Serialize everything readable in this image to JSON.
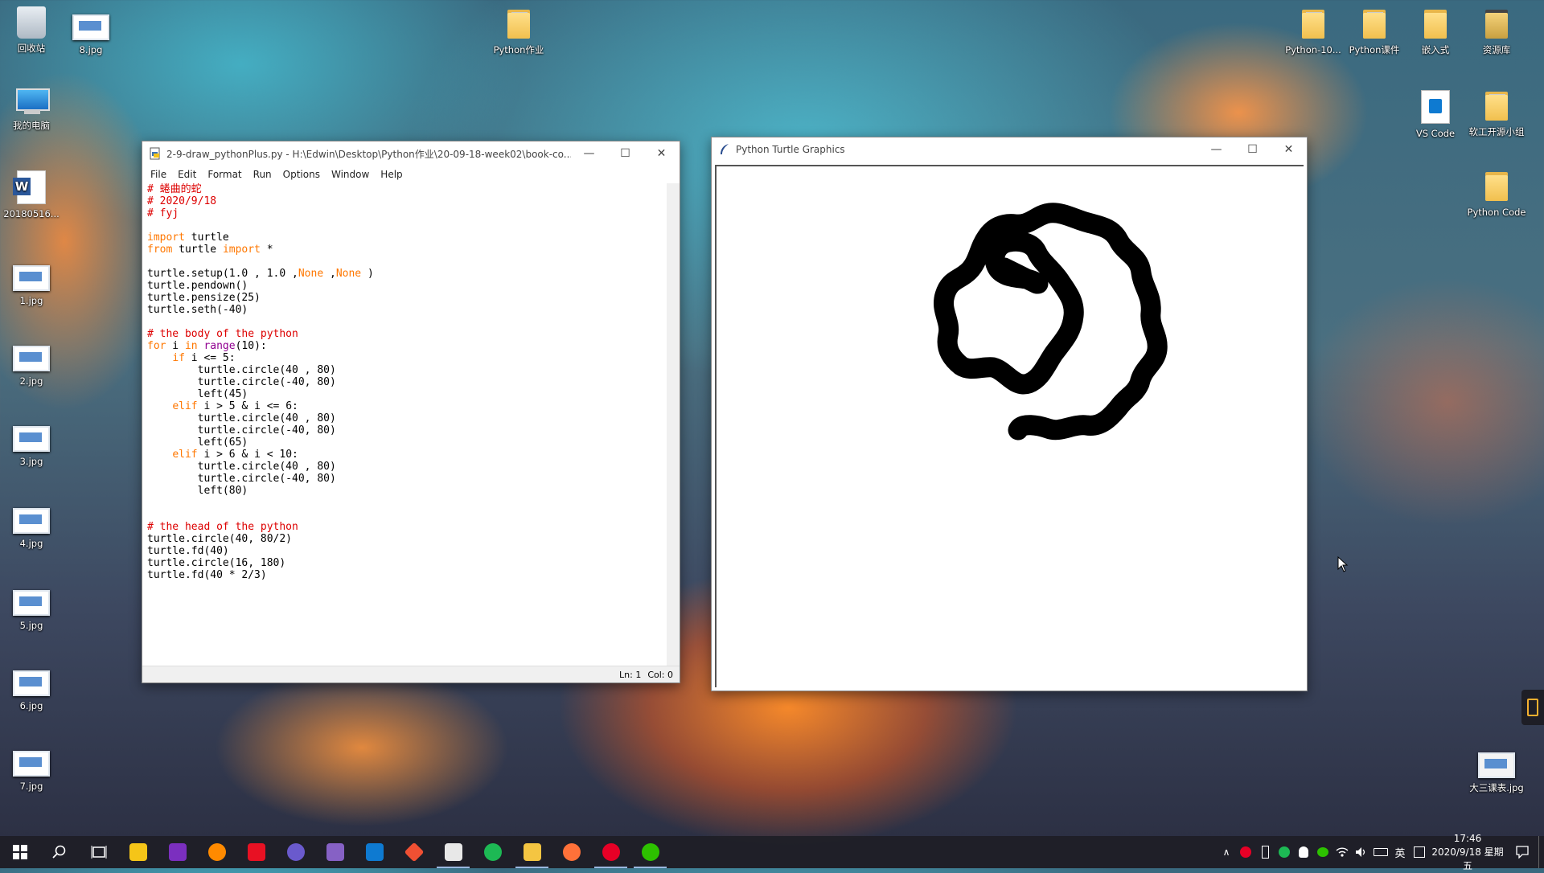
{
  "desktop": {
    "icons": [
      {
        "label": "回收站"
      },
      {
        "label": "8.jpg"
      },
      {
        "label": "我的电脑"
      },
      {
        "label": "20180516..."
      },
      {
        "label": "1.jpg"
      },
      {
        "label": "2.jpg"
      },
      {
        "label": "3.jpg"
      },
      {
        "label": "4.jpg"
      },
      {
        "label": "5.jpg"
      },
      {
        "label": "6.jpg"
      },
      {
        "label": "7.jpg"
      },
      {
        "label": "Python作业"
      },
      {
        "label": "Python-10..."
      },
      {
        "label": "Python课件"
      },
      {
        "label": "嵌入式"
      },
      {
        "label": "资源库"
      },
      {
        "label": "VS Code"
      },
      {
        "label": "软工开源小组"
      },
      {
        "label": "Python Code"
      },
      {
        "label": "大三课表.jpg"
      }
    ]
  },
  "editor": {
    "title": "2-9-draw_pythonPlus.py - H:\\Edwin\\Desktop\\Python作业\\20-09-18-week02\\book-co...",
    "menu": [
      "File",
      "Edit",
      "Format",
      "Run",
      "Options",
      "Window",
      "Help"
    ],
    "code": [
      [
        {
          "c": "cm",
          "t": "# 蜷曲的蛇"
        }
      ],
      [
        {
          "c": "cm",
          "t": "# 2020/9/18"
        }
      ],
      [
        {
          "c": "cm",
          "t": "# fyj"
        }
      ],
      [],
      [
        {
          "c": "kw",
          "t": "import"
        },
        {
          "t": " turtle"
        }
      ],
      [
        {
          "c": "kw",
          "t": "from"
        },
        {
          "t": " turtle "
        },
        {
          "c": "kw",
          "t": "import"
        },
        {
          "t": " *"
        }
      ],
      [],
      [
        {
          "t": "turtle.setup(1.0 , 1.0 ,"
        },
        {
          "c": "kw",
          "t": "None"
        },
        {
          "t": " ,"
        },
        {
          "c": "kw",
          "t": "None"
        },
        {
          "t": " )"
        }
      ],
      [
        {
          "t": "turtle.pendown()"
        }
      ],
      [
        {
          "t": "turtle.pensize(25)"
        }
      ],
      [
        {
          "t": "turtle.seth(-40)"
        }
      ],
      [],
      [
        {
          "c": "cm",
          "t": "# the body of the python"
        }
      ],
      [
        {
          "c": "kw",
          "t": "for"
        },
        {
          "t": " i "
        },
        {
          "c": "kw",
          "t": "in"
        },
        {
          "t": " "
        },
        {
          "c": "bi",
          "t": "range"
        },
        {
          "t": "(10):"
        }
      ],
      [
        {
          "t": "    "
        },
        {
          "c": "kw",
          "t": "if"
        },
        {
          "t": " i <= 5:"
        }
      ],
      [
        {
          "t": "        turtle.circle(40 , 80)"
        }
      ],
      [
        {
          "t": "        turtle.circle(-40, 80)"
        }
      ],
      [
        {
          "t": "        left(45)"
        }
      ],
      [
        {
          "t": "    "
        },
        {
          "c": "kw",
          "t": "elif"
        },
        {
          "t": " i > 5 & i <= 6:"
        }
      ],
      [
        {
          "t": "        turtle.circle(40 , 80)"
        }
      ],
      [
        {
          "t": "        turtle.circle(-40, 80)"
        }
      ],
      [
        {
          "t": "        left(65)"
        }
      ],
      [
        {
          "t": "    "
        },
        {
          "c": "kw",
          "t": "elif"
        },
        {
          "t": " i > 6 & i < 10:"
        }
      ],
      [
        {
          "t": "        turtle.circle(40 , 80)"
        }
      ],
      [
        {
          "t": "        turtle.circle(-40, 80)"
        }
      ],
      [
        {
          "t": "        left(80)"
        }
      ],
      [],
      [],
      [
        {
          "c": "cm",
          "t": "# the head of the python"
        }
      ],
      [
        {
          "t": "turtle.circle(40, 80/2)"
        }
      ],
      [
        {
          "t": "turtle.fd(40)"
        }
      ],
      [
        {
          "t": "turtle.circle(16, 180)"
        }
      ],
      [
        {
          "t": "turtle.fd(40 * 2/3)"
        }
      ]
    ],
    "status": {
      "line": "Ln: 1",
      "col": "Col: 0"
    }
  },
  "turtle_window": {
    "title": "Python Turtle Graphics"
  },
  "taskbar": {
    "clock_time": "17:46",
    "clock_date": "2020/9/18 星期五",
    "ime": "英",
    "icon_colors": [
      "#f5c518",
      "#7b2fbf",
      "#ff8a00",
      "#e81123",
      "#6a5acd",
      "#8661c5",
      "#0e7ad1",
      "#f05033",
      "#e8e8e8",
      "#1db954",
      "#f4c542",
      "#ff7139",
      "#e60026",
      "#2dc100"
    ]
  }
}
